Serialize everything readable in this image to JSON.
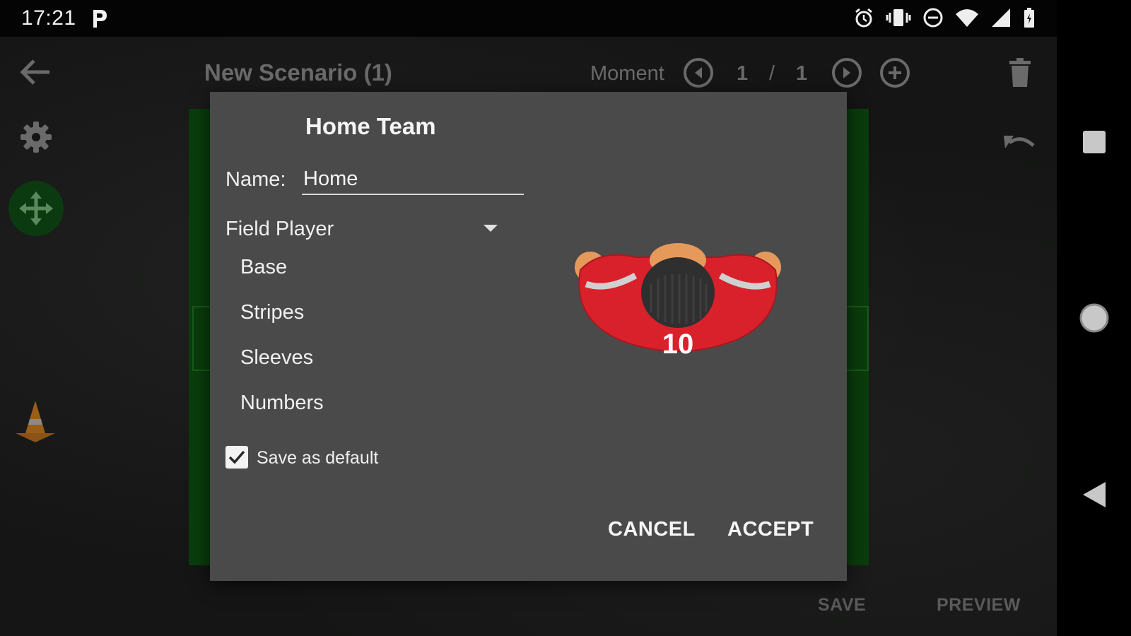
{
  "status_bar": {
    "time": "17:21",
    "icons": [
      "parking-icon",
      "alarm-icon",
      "vibrate-icon",
      "dnd-icon",
      "wifi-icon",
      "signal-icon",
      "battery-icon"
    ]
  },
  "app_bar": {
    "title": "New Scenario (1)",
    "moment_label": "Moment",
    "moment_current": "1",
    "moment_separator": "/",
    "moment_total": "1"
  },
  "bottom_actions": {
    "save": "SAVE",
    "preview": "PREVIEW"
  },
  "dialog": {
    "title": "Home Team",
    "name_label": "Name:",
    "name_value": "Home",
    "player_type": "Field Player",
    "options": [
      "Base",
      "Stripes",
      "Sleeves",
      "Numbers"
    ],
    "save_default_label": "Save as default",
    "save_default_checked": true,
    "cancel_label": "CANCEL",
    "accept_label": "ACCEPT",
    "jersey_number": "10"
  },
  "colors": {
    "dialog_bg": "#4a4a4a",
    "field_green": "#0a3c0c",
    "jersey_red": "#d9212b",
    "skin": "#e59a5c"
  }
}
